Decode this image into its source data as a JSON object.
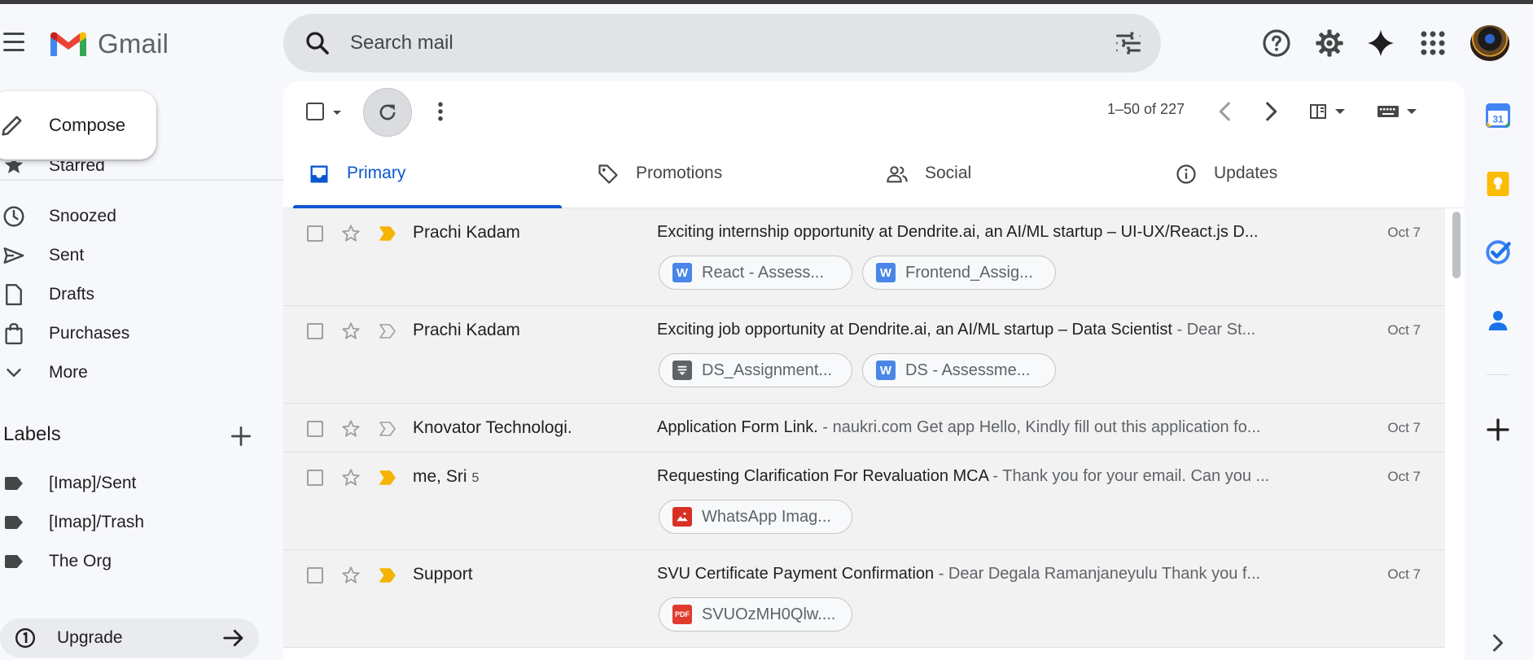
{
  "app": {
    "name": "Gmail"
  },
  "search": {
    "placeholder": "Search mail"
  },
  "compose": {
    "label": "Compose"
  },
  "sidebar": {
    "partial_item": "Starred",
    "items": [
      {
        "label": "Snoozed",
        "icon": "clock-icon"
      },
      {
        "label": "Sent",
        "icon": "send-icon"
      },
      {
        "label": "Drafts",
        "icon": "draft-icon"
      },
      {
        "label": "Purchases",
        "icon": "shopping-bag-icon"
      },
      {
        "label": "More",
        "icon": "chevron-down-icon"
      }
    ],
    "labels_header": "Labels",
    "labels": [
      "[Imap]/Sent",
      "[Imap]/Trash",
      "The Org"
    ],
    "upgrade": "Upgrade"
  },
  "toolbar": {
    "pager": "1–50 of 227"
  },
  "tabs": [
    {
      "label": "Primary",
      "icon": "inbox-icon",
      "active": true
    },
    {
      "label": "Promotions",
      "icon": "tag-icon",
      "active": false
    },
    {
      "label": "Social",
      "icon": "people-icon",
      "active": false
    },
    {
      "label": "Updates",
      "icon": "info-icon",
      "active": false
    }
  ],
  "emails": [
    {
      "sender": "Prachi Kadam",
      "count": "",
      "important": true,
      "subject": "Exciting internship opportunity at Dendrite.ai, an AI/ML startup – UI-UX/React.js D...",
      "snippet": "",
      "date": "Oct 7",
      "attachments": [
        {
          "name": "React - Assess...",
          "type": "word"
        },
        {
          "name": "Frontend_Assig...",
          "type": "word"
        }
      ]
    },
    {
      "sender": "Prachi Kadam",
      "count": "",
      "important": false,
      "subject": "Exciting job opportunity at Dendrite.ai, an AI/ML startup – Data Scientist",
      "snippet": " - Dear St...",
      "date": "Oct 7",
      "attachments": [
        {
          "name": "DS_Assignment...",
          "type": "doc"
        },
        {
          "name": "DS - Assessme...",
          "type": "word"
        }
      ]
    },
    {
      "sender": "Knovator Technologi.",
      "count": "",
      "important": false,
      "subject": "Application Form Link.",
      "snippet": " - naukri.com Get app Hello, Kindly fill out this application fo...",
      "date": "Oct 7",
      "attachments": []
    },
    {
      "sender": "me, Sri",
      "count": "5",
      "important": true,
      "subject": "Requesting Clarification For Revaluation MCA",
      "snippet": " - Thank you for your email. Can you ...",
      "date": "Oct 7",
      "attachments": [
        {
          "name": "WhatsApp Imag...",
          "type": "image"
        }
      ]
    },
    {
      "sender": "Support",
      "count": "",
      "important": true,
      "subject": "SVU Certificate Payment Confirmation",
      "snippet": " - Dear Degala Ramanjaneyulu Thank you f...",
      "date": "Oct 7",
      "attachments": [
        {
          "name": "SVUOzMH0Qlw....",
          "type": "pdf"
        }
      ]
    }
  ],
  "colors": {
    "accent": "#0b57d0",
    "important": "#f4b400",
    "word": "#4a86e8",
    "pdf": "#e03b2f",
    "image": "#d93025",
    "doc": "#5f6368"
  }
}
